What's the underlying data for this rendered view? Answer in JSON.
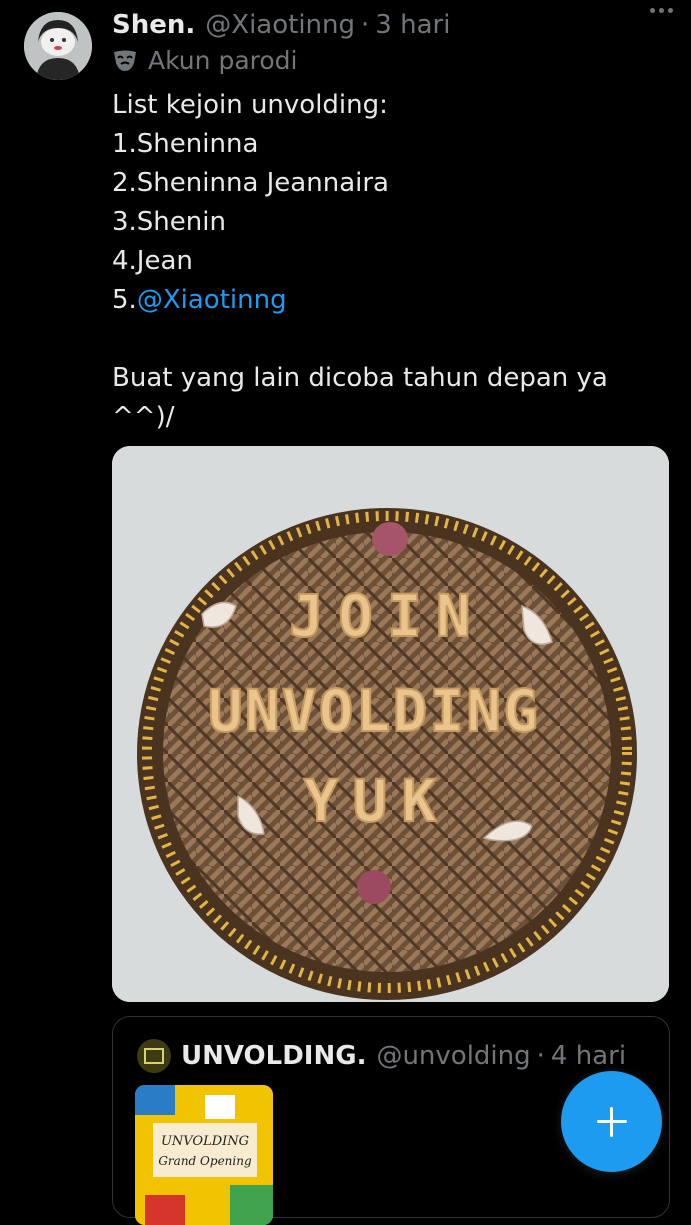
{
  "tweet": {
    "author_name": "Shen.",
    "handle": "@Xiaotinng",
    "separator": "·",
    "time": "3 hari",
    "badge": "Akun parodi",
    "lines": [
      "List kejoin unvolding:",
      "1.Sheninna",
      "2.Sheninna Jeannaira",
      "3.Shenin",
      "4.Jean"
    ],
    "mention_prefix": "5.",
    "mention": "@Xiaotinng",
    "closing_line_1": "Buat yang lain dicoba tahun depan ya",
    "closing_line_2": "^^)/"
  },
  "media": {
    "text_line_1": "JOIN",
    "text_line_2": "UNVOLDING",
    "text_line_3": "YUK"
  },
  "quote": {
    "author_name": "UNVOLDING.",
    "handle": "@unvolding",
    "separator": "·",
    "time": "4 hari",
    "thumb_title": "UNVOLDING",
    "thumb_subtitle": "Grand Opening"
  },
  "icons": {
    "more": "more-dots-icon",
    "parody": "mask-icon",
    "compose": "plus-icon"
  },
  "colors": {
    "background": "#000000",
    "text": "#e7e9ea",
    "muted": "#71767b",
    "link": "#1d9bf0",
    "fab": "#1d9bf0"
  }
}
